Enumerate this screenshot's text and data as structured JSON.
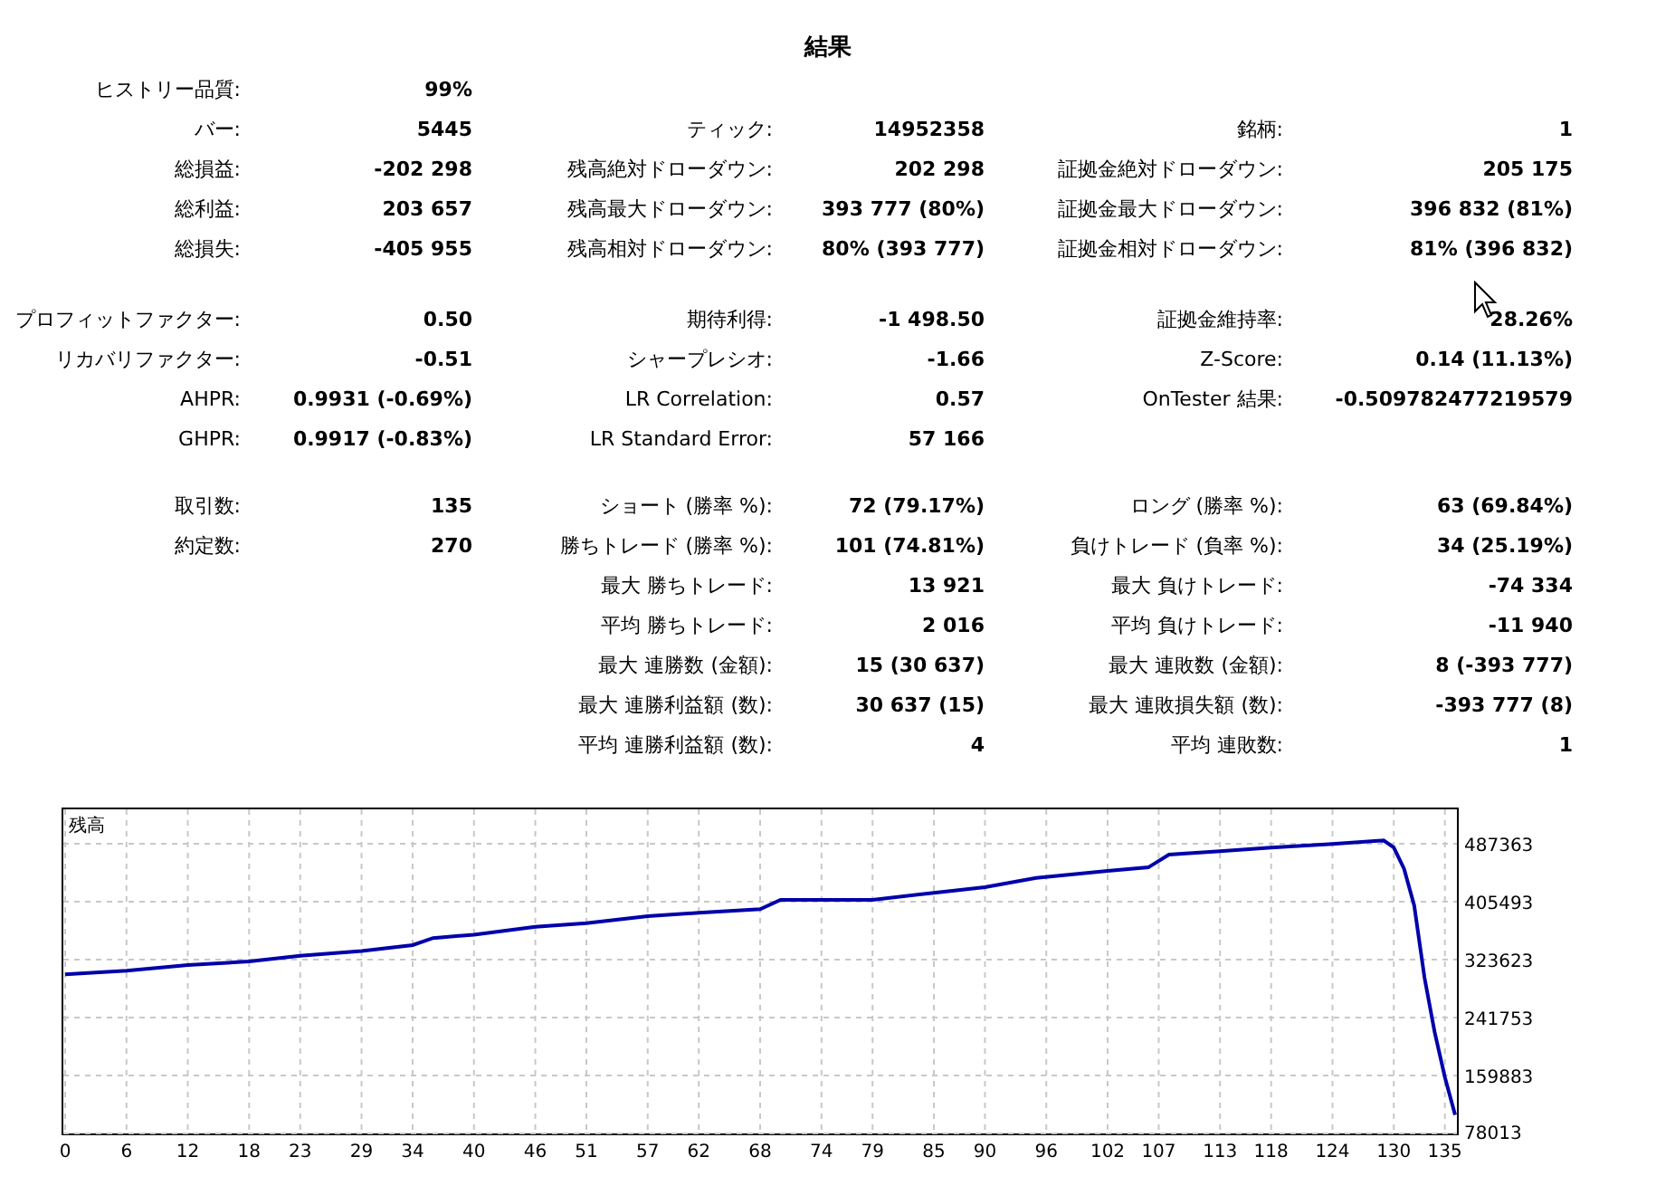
{
  "title": "結果",
  "sections": [
    {
      "rows": [
        {
          "left": {
            "label": "ヒストリー品質:",
            "value": "99%"
          }
        },
        {
          "left": {
            "label": "バー:",
            "value": "5445"
          },
          "middle": {
            "label": "ティック:",
            "value": "14952358"
          },
          "right": {
            "label": "銘柄:",
            "value": "1"
          }
        },
        {
          "left": {
            "label": "総損益:",
            "value": "-202 298"
          },
          "middle": {
            "label": "残高絶対ドローダウン:",
            "value": "202 298"
          },
          "right": {
            "label": "証拠金絶対ドローダウン:",
            "value": "205 175"
          }
        },
        {
          "left": {
            "label": "総利益:",
            "value": "203 657"
          },
          "middle": {
            "label": "残高最大ドローダウン:",
            "value": "393 777 (80%)"
          },
          "right": {
            "label": "証拠金最大ドローダウン:",
            "value": "396 832 (81%)"
          }
        },
        {
          "left": {
            "label": "総損失:",
            "value": "-405 955"
          },
          "middle": {
            "label": "残高相対ドローダウン:",
            "value": "80% (393 777)"
          },
          "right": {
            "label": "証拠金相対ドローダウン:",
            "value": "81% (396 832)"
          }
        }
      ]
    },
    {
      "rows": [
        {
          "left": {
            "label": "プロフィットファクター:",
            "value": "0.50"
          },
          "middle": {
            "label": "期待利得:",
            "value": "-1 498.50"
          },
          "right": {
            "label": "証拠金維持率:",
            "value": "28.26%"
          }
        },
        {
          "left": {
            "label": "リカバリファクター:",
            "value": "-0.51"
          },
          "middle": {
            "label": "シャープレシオ:",
            "value": "-1.66"
          },
          "right": {
            "label": "Z-Score:",
            "value": "0.14 (11.13%)"
          }
        },
        {
          "left": {
            "label": "AHPR:",
            "value": "0.9931 (-0.69%)"
          },
          "middle": {
            "label": "LR Correlation:",
            "value": "0.57"
          },
          "right": {
            "label": "OnTester 結果:",
            "value": "-0.509782477219579"
          }
        },
        {
          "left": {
            "label": "GHPR:",
            "value": "0.9917 (-0.83%)"
          },
          "middle": {
            "label": "LR Standard Error:",
            "value": "57 166"
          }
        }
      ]
    },
    {
      "rows": [
        {
          "left": {
            "label": "取引数:",
            "value": "135"
          },
          "middle": {
            "label": "ショート (勝率 %):",
            "value": "72 (79.17%)"
          },
          "right": {
            "label": "ロング (勝率 %):",
            "value": "63 (69.84%)"
          }
        },
        {
          "left": {
            "label": "約定数:",
            "value": "270"
          },
          "middle": {
            "label": "勝ちトレード (勝率 %):",
            "value": "101 (74.81%)"
          },
          "right": {
            "label": "負けトレード (負率 %):",
            "value": "34 (25.19%)"
          }
        },
        {
          "middle": {
            "label": "最大 勝ちトレード:",
            "value": "13 921"
          },
          "right": {
            "label": "最大 負けトレード:",
            "value": "-74 334"
          }
        },
        {
          "middle": {
            "label": "平均 勝ちトレード:",
            "value": "2 016"
          },
          "right": {
            "label": "平均 負けトレード:",
            "value": "-11 940"
          }
        },
        {
          "middle": {
            "label": "最大 連勝数 (金額):",
            "value": "15 (30 637)"
          },
          "right": {
            "label": "最大 連敗数 (金額):",
            "value": "8 (-393 777)"
          }
        },
        {
          "middle": {
            "label": "最大 連勝利益額 (数):",
            "value": "30 637 (15)"
          },
          "right": {
            "label": "最大 連敗損失額 (数):",
            "value": "-393 777 (8)"
          }
        },
        {
          "middle": {
            "label": "平均 連勝利益額 (数):",
            "value": "4"
          },
          "right": {
            "label": "平均 連敗数:",
            "value": "1"
          }
        }
      ]
    }
  ],
  "chart_data": {
    "type": "line",
    "title": "残高",
    "x": [
      0,
      6,
      12,
      18,
      23,
      29,
      34,
      36,
      40,
      46,
      51,
      57,
      62,
      68,
      70,
      79,
      85,
      90,
      95,
      102,
      106,
      108,
      113,
      118,
      124,
      129,
      130,
      131,
      132,
      133,
      134,
      135,
      136
    ],
    "series": [
      {
        "color": "#0000aa",
        "values": [
          303000,
          308000,
          316000,
          321000,
          329000,
          336000,
          344000,
          354000,
          359000,
          370000,
          375000,
          385000,
          390000,
          395000,
          408000,
          408000,
          418000,
          426000,
          439000,
          449000,
          454000,
          472000,
          477000,
          482000,
          487000,
          492000,
          482000,
          452000,
          400000,
          298000,
          221000,
          157000,
          104000
        ]
      }
    ],
    "grid": true,
    "xlim": [
      0,
      136
    ],
    "ylim": [
      78013,
      538532
    ],
    "xticks": [
      0,
      6,
      12,
      18,
      23,
      29,
      34,
      40,
      46,
      51,
      57,
      62,
      68,
      74,
      79,
      85,
      90,
      96,
      102,
      107,
      113,
      118,
      124,
      130,
      135
    ],
    "yticks": [
      78013,
      159883,
      241753,
      323623,
      405493,
      487363
    ]
  }
}
